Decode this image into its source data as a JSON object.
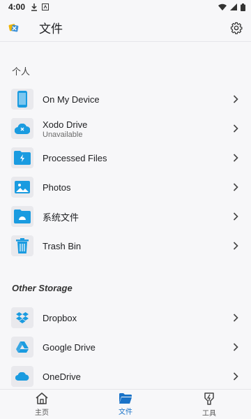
{
  "status_bar": {
    "time": "4:00"
  },
  "app_bar": {
    "title": "文件"
  },
  "sections": [
    {
      "label": "个人",
      "items": [
        {
          "icon": "phone-icon",
          "label": "On My Device",
          "sublabel": ""
        },
        {
          "icon": "cloud-icon",
          "label": "Xodo Drive",
          "sublabel": "Unavailable"
        },
        {
          "icon": "folder-bolt-icon",
          "label": "Processed Files",
          "sublabel": ""
        },
        {
          "icon": "image-icon",
          "label": "Photos",
          "sublabel": ""
        },
        {
          "icon": "folder-icon",
          "label": "系统文件",
          "sublabel": ""
        },
        {
          "icon": "trash-icon",
          "label": "Trash Bin",
          "sublabel": ""
        }
      ]
    },
    {
      "label": "Other Storage",
      "items": [
        {
          "icon": "dropbox-icon",
          "label": "Dropbox",
          "sublabel": ""
        },
        {
          "icon": "google-drive-icon",
          "label": "Google Drive",
          "sublabel": ""
        },
        {
          "icon": "onedrive-icon",
          "label": "OneDrive",
          "sublabel": ""
        }
      ]
    }
  ],
  "bottom_nav": [
    {
      "icon": "home-icon",
      "label": "主页",
      "active": false
    },
    {
      "icon": "folder-open-icon",
      "label": "文件",
      "active": true
    },
    {
      "icon": "tools-icon",
      "label": "工具",
      "active": false
    }
  ],
  "colors": {
    "accent": "#1a9be0",
    "active_nav": "#1a73c8",
    "icon_bg": "#e9e9ed"
  }
}
